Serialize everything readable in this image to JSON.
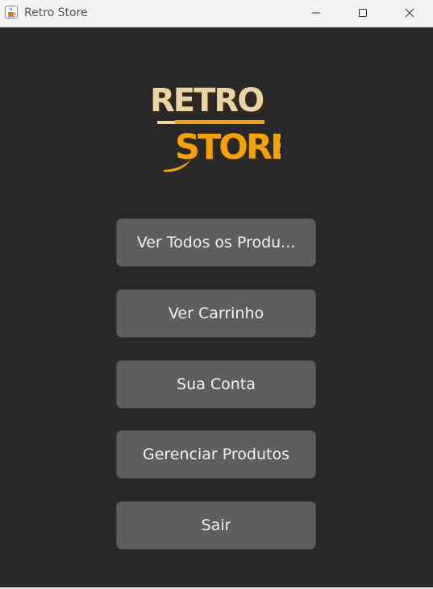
{
  "window": {
    "title": "Retro Store"
  },
  "logo": {
    "line1": "RETRO",
    "line2": "STORE"
  },
  "menu": [
    {
      "label": "Ver Todos os Produ..."
    },
    {
      "label": "Ver Carrinho"
    },
    {
      "label": "Sua Conta"
    },
    {
      "label": "Gerenciar Produtos"
    },
    {
      "label": "Sair"
    }
  ],
  "colors": {
    "background": "#282828",
    "button": "#5f5e5c",
    "button_text": "#f2f2f2",
    "logo_retro": "#e8d4a6",
    "logo_store": "#f2a10c",
    "logo_shadow": "#3a2a14"
  },
  "icons": {
    "app": "java-coffee-icon",
    "minimize": "minimize-icon",
    "maximize": "maximize-icon",
    "close": "close-icon"
  }
}
